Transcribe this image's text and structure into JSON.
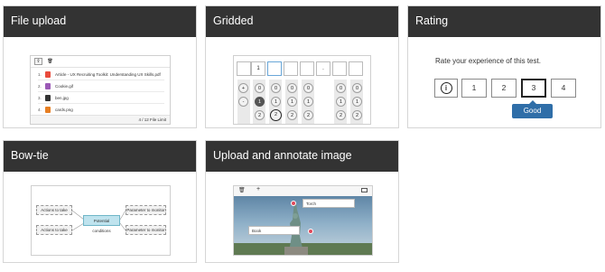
{
  "cards": {
    "file_upload": {
      "title": "File upload",
      "files": [
        {
          "num": "1.",
          "name": "Article - UX Recruiting Toolkit: Understanding UX Skills.pdf",
          "color": "#e94b3c"
        },
        {
          "num": "2.",
          "name": "Cookie.gif",
          "color": "#9b59b6"
        },
        {
          "num": "3.",
          "name": "ben.jpg",
          "color": "#333333"
        },
        {
          "num": "4.",
          "name": "cards.png",
          "color": "#e67e22"
        }
      ],
      "limit": "4 / 12 File Limit",
      "upload_icon": "upload-icon",
      "delete_icon": "trash-icon"
    },
    "gridded": {
      "title": "Gridded",
      "cells": [
        "",
        "1",
        "",
        "",
        "",
        ".",
        "",
        ""
      ],
      "rows": [
        [
          "+",
          "0",
          "0",
          "0",
          "0",
          "",
          "0",
          "0"
        ],
        [
          "-",
          "1",
          "1",
          "1",
          "1",
          "",
          "1",
          "1"
        ],
        [
          "",
          "2",
          "2",
          "2",
          "2",
          "",
          "2",
          "2"
        ]
      ],
      "selected": {
        "row1col": "1",
        "row2col": "2"
      }
    },
    "rating": {
      "title": "Rating",
      "prompt": "Rate your experience of this test.",
      "options": [
        "1",
        "2",
        "3",
        "4"
      ],
      "selected": "3",
      "tooltip": "Good",
      "info_icon": "info-icon"
    },
    "bow_tie": {
      "title": "Bow-tie",
      "left_boxes": [
        "Actions to take",
        "Actions to take"
      ],
      "center": "Potential conditions",
      "right_boxes": [
        "Parameter to monitor",
        "Parameter to monitor"
      ]
    },
    "annotate": {
      "title": "Upload and annotate image",
      "labels": [
        "Torch",
        "Book"
      ],
      "toolbar_icons": [
        "trash-icon",
        "plus-icon",
        "image-icon"
      ]
    }
  }
}
